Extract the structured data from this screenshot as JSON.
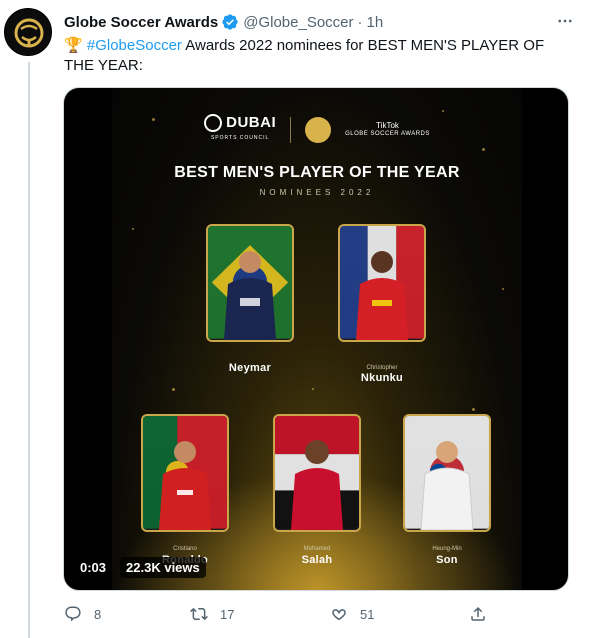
{
  "tweet": {
    "author_name": "Globe Soccer Awards",
    "handle": "@Globe_Soccer",
    "separator": "·",
    "time": "1h",
    "more_icon": "more-horizontal-icon",
    "verified_icon": "verified-badge-icon",
    "text_emoji": "🏆",
    "hashtag": "#GlobeSoccer",
    "text_body": " Awards 2022 nominees for BEST MEN'S PLAYER OF THE YEAR:"
  },
  "media": {
    "sponsor_dubai": "DUBAI",
    "sponsor_dubai_sub": "SPORTS COUNCIL",
    "partner_top": "TikTok",
    "partner_bottom": "GLOBE SOCCER AWARDS",
    "poster_title": "BEST MEN'S PLAYER OF THE YEAR",
    "poster_subtitle": "NOMINEES 2022",
    "players": [
      {
        "first": "",
        "last": "Neymar"
      },
      {
        "first": "Christopher",
        "last": "Nkunku"
      },
      {
        "first": "Cristiano",
        "last": "Ronaldo"
      },
      {
        "first": "Mohamed",
        "last": "Salah"
      },
      {
        "first": "Heung-Min",
        "last": "Son"
      }
    ],
    "elapsed": "0:03",
    "views": "22.3K views"
  },
  "actions": {
    "reply_count": "8",
    "retweet_count": "17",
    "like_count": "51",
    "reply_icon": "reply-icon",
    "retweet_icon": "retweet-icon",
    "like_icon": "heart-icon",
    "share_icon": "share-icon"
  },
  "colors": {
    "link": "#1d9bf0",
    "muted": "#536471",
    "gold": "#c9a64a"
  }
}
